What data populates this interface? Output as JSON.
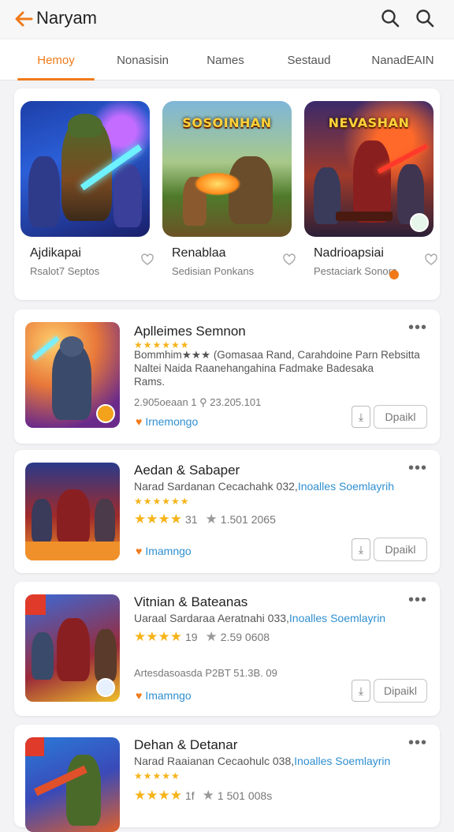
{
  "header": {
    "title": "Naryam",
    "back_icon": "arrow-left-icon",
    "search_icons": [
      "search-icon",
      "search-icon"
    ]
  },
  "tabs": [
    {
      "label": "Hemoy",
      "active": true
    },
    {
      "label": "Nonasisin",
      "active": false
    },
    {
      "label": "Names",
      "active": false
    },
    {
      "label": "Sestaud",
      "active": false
    },
    {
      "label": "NanadEAIN",
      "active": false
    }
  ],
  "featured": [
    {
      "name": "Ajdikapai",
      "subtitle": "Rsalot7 Septos",
      "art_title": ""
    },
    {
      "name": "Renablaa",
      "subtitle": "Sedisian Ponkans",
      "art_title": "SOSOINHAN"
    },
    {
      "name": "Nadrioapsiai",
      "subtitle": "Pestaciark Sonors",
      "art_title": "NEVASHAN"
    }
  ],
  "list": [
    {
      "title": "Aplleimes Semnon",
      "rating_stars": "★★★★★★",
      "desc1": "Bommhim★★★ (Gomasaa Rand, Carahdoine Parn Rebsitta",
      "desc2": "Naltei Naida Raanehangahina Fadmake Badesaka",
      "desc3": "Rams.",
      "meta": "2.905oeaan 1 ⚲ 23.205.101",
      "developer": "Irnemongo",
      "open_label": "Dpaikl"
    },
    {
      "title": "Aedan & Sabaper",
      "desc1": "Narad Sardanan Cecachahk 032,",
      "desc1_blue": "Inoalles Soemlayrih",
      "rating_stars": "★★★★★★",
      "big_stars": "★★★★",
      "big_rating": "31",
      "meta": "1.501 2065",
      "developer": "Imamngo",
      "open_label": "Dpaikl"
    },
    {
      "title": "Vitnian & Bateanas",
      "desc1": "Uaraal Sardaraa Aeratnahi 033,",
      "desc1_blue": "Inoalles Soemlayrin",
      "big_stars": "★★★★",
      "big_rating": "19",
      "meta": "2.59 0608",
      "meta2": "Artesdasoasda P2BT 51.3B. 09",
      "developer": "Imamngo",
      "open_label": "Dipaikl"
    },
    {
      "title": "Dehan & Detanar",
      "desc1": "Narad Raaianan Cecaohulc 038,",
      "desc1_blue": "Inoalles Soemlayrin",
      "rating_stars": "★★★★★",
      "big_stars": "★★★★",
      "big_rating": "1f",
      "meta": "1 501 008s"
    }
  ],
  "colors": {
    "accent": "#f07a1a",
    "star": "#f6b41a",
    "link": "#2f8fd0"
  }
}
